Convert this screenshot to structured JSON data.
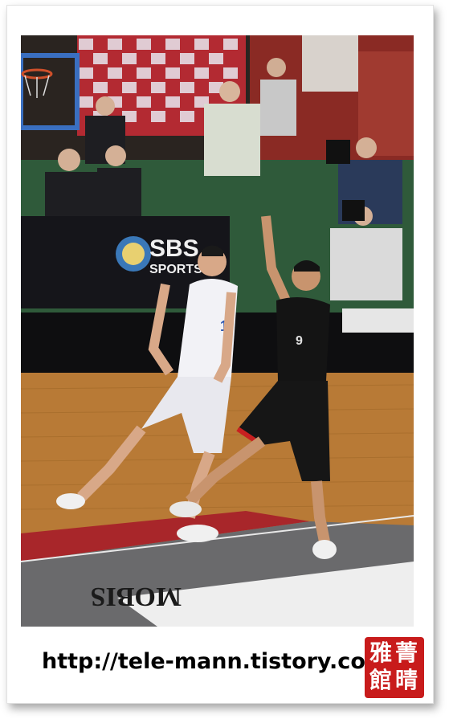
{
  "photo": {
    "subject": "basketball-game-photo",
    "banner_text": "SBS SPORTS",
    "floor_text": "MOBIS",
    "jersey_numbers": [
      "1",
      "9"
    ]
  },
  "caption": {
    "url": "http://tele-mann.tistory.com"
  },
  "seal": {
    "glyphs": [
      "雅",
      "菁",
      "館",
      "晴"
    ],
    "color": "#c81b1b"
  }
}
